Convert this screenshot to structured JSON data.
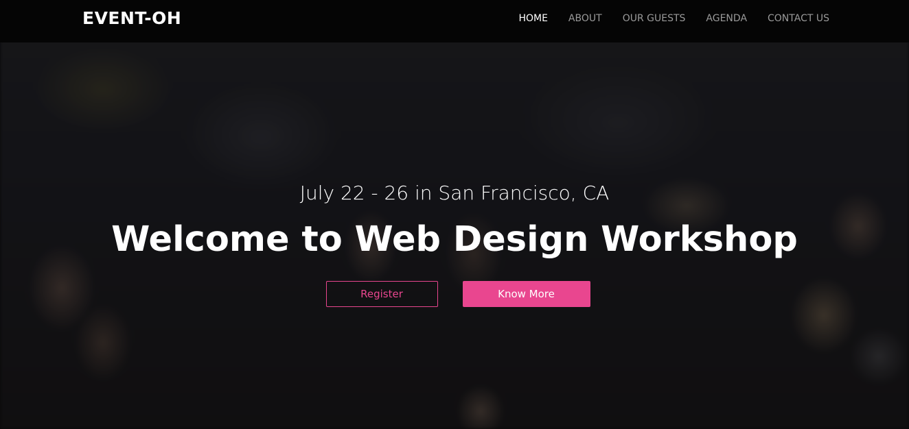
{
  "navbar": {
    "brand": "EVENT-OH",
    "links": [
      {
        "label": "HOME",
        "active": true
      },
      {
        "label": "ABOUT",
        "active": false
      },
      {
        "label": "OUR GUESTS",
        "active": false
      },
      {
        "label": "AGENDA",
        "active": false
      },
      {
        "label": "CONTACT US",
        "active": false
      }
    ]
  },
  "hero": {
    "date_location": "July 22 - 26 in San Francisco, CA",
    "title": "Welcome to Web Design Workshop",
    "register_label": "Register",
    "know_more_label": "Know More"
  },
  "colors": {
    "accent": "#e9468f",
    "navbar_bg": "#050505",
    "nav_active": "#ffffff",
    "nav_inactive": "#9a9a9a"
  }
}
